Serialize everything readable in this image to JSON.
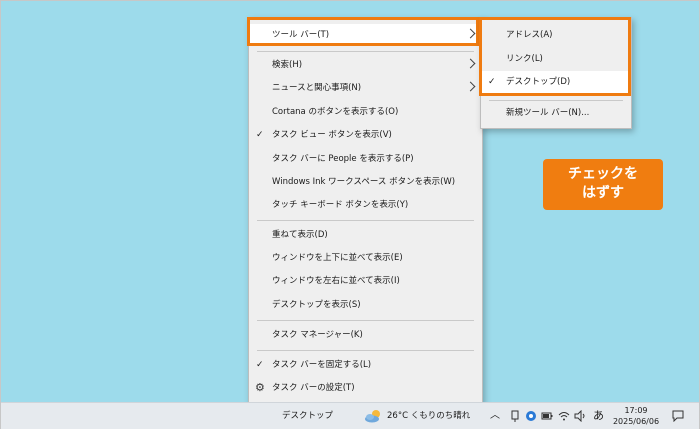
{
  "menu": {
    "items": [
      {
        "label": "ツール バー(T)",
        "submenu": true,
        "checked": false
      },
      {
        "label": "検索(H)",
        "submenu": true,
        "checked": false
      },
      {
        "label": "ニュースと関心事項(N)",
        "submenu": true,
        "checked": false
      },
      {
        "label": "Cortana のボタンを表示する(O)",
        "submenu": false,
        "checked": false
      },
      {
        "label": "タスク ビュー ボタンを表示(V)",
        "submenu": false,
        "checked": true
      },
      {
        "label": "タスク バーに People を表示する(P)",
        "submenu": false,
        "checked": false
      },
      {
        "label": "Windows Ink ワークスペース ボタンを表示(W)",
        "submenu": false,
        "checked": false
      },
      {
        "label": "タッチ キーボード ボタンを表示(Y)",
        "submenu": false,
        "checked": false
      },
      {
        "label": "重ねて表示(D)",
        "submenu": false,
        "checked": false
      },
      {
        "label": "ウィンドウを上下に並べて表示(E)",
        "submenu": false,
        "checked": false
      },
      {
        "label": "ウィンドウを左右に並べて表示(I)",
        "submenu": false,
        "checked": false
      },
      {
        "label": "デスクトップを表示(S)",
        "submenu": false,
        "checked": false
      },
      {
        "label": "タスク マネージャー(K)",
        "submenu": false,
        "checked": false
      },
      {
        "label": "タスク バーを固定する(L)",
        "submenu": false,
        "checked": true
      },
      {
        "label": "タスク バーの設定(T)",
        "submenu": false,
        "checked": false
      }
    ],
    "check_glyph": "✓"
  },
  "submenu": {
    "items": [
      {
        "label": "アドレス(A)",
        "checked": false
      },
      {
        "label": "リンク(L)",
        "checked": false
      },
      {
        "label": "デスクトップ(D)",
        "checked": true
      },
      {
        "label": "新規ツール バー(N)...",
        "checked": false
      }
    ]
  },
  "callout": {
    "line1": "チェックを",
    "line2": "はずす"
  },
  "taskbar": {
    "desktop_label": "デスクトップ",
    "weather": "26°C くもりのち晴れ",
    "ime": "あ",
    "time": "17:09",
    "date": "2025/06/06"
  },
  "colors": {
    "accent": "#ef7b10",
    "desktop": "#9ddbeb"
  }
}
